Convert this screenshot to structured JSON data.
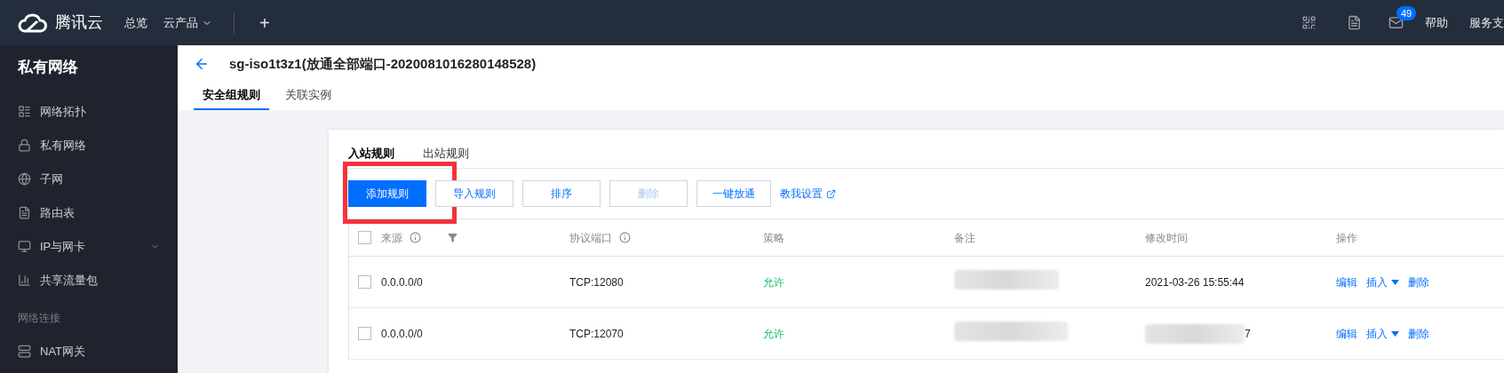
{
  "top_bar": {
    "brand": "腾讯云",
    "nav": [
      {
        "label": "总览",
        "dropdown": false
      },
      {
        "label": "云产品",
        "dropdown": true
      }
    ],
    "add": "+",
    "mail_badge": "49",
    "links": [
      "帮助",
      "服务支"
    ]
  },
  "sidebar": {
    "title": "私有网络",
    "items": [
      {
        "kind": "item",
        "label": "网络拓扑",
        "expandable": false
      },
      {
        "kind": "item",
        "label": "私有网络",
        "expandable": false
      },
      {
        "kind": "item",
        "label": "子网",
        "expandable": false
      },
      {
        "kind": "item",
        "label": "路由表",
        "expandable": false
      },
      {
        "kind": "item",
        "label": "IP与网卡",
        "expandable": true
      },
      {
        "kind": "item",
        "label": "共享流量包",
        "expandable": false
      },
      {
        "kind": "section",
        "label": "网络连接"
      },
      {
        "kind": "item",
        "label": "NAT网关",
        "expandable": false
      }
    ]
  },
  "header": {
    "back": true,
    "title": "sg-iso1t3z1(放通全部端口-2020081016280148528)",
    "tabs": [
      {
        "label": "安全组规则",
        "selected": true
      },
      {
        "label": "关联实例",
        "selected": false
      }
    ]
  },
  "card": {
    "tabs": [
      {
        "label": "入站规则",
        "selected": true
      },
      {
        "label": "出站规则",
        "selected": false
      }
    ],
    "buttons": [
      {
        "label": "添加规则",
        "kind": "primary",
        "disabled": false,
        "highlighted": true
      },
      {
        "label": "导入规则",
        "kind": "default",
        "disabled": false,
        "highlighted": false
      },
      {
        "label": "排序",
        "kind": "default",
        "disabled": false,
        "highlighted": false
      },
      {
        "label": "删除",
        "kind": "default",
        "disabled": true,
        "highlighted": false
      },
      {
        "label": "一键放通",
        "kind": "default",
        "disabled": false,
        "highlighted": false
      }
    ],
    "help_link": "教我设置",
    "table": {
      "all_checked": false,
      "columns": [
        "来源",
        "协议端口",
        "策略",
        "备注",
        "修改时间",
        "操作"
      ],
      "rows": [
        {
          "checked": false,
          "source": "0.0.0.0/0",
          "port": "TCP:12080",
          "policy": "允许",
          "note_redacted": true,
          "time": "2021-03-26 15:55:44",
          "time_redacted": false,
          "actions": [
            "编辑",
            "插入",
            "删除"
          ]
        },
        {
          "checked": false,
          "source": "0.0.0.0/0",
          "port": "TCP:12070",
          "policy": "允许",
          "note_redacted": true,
          "time": "7",
          "time_redacted": true,
          "actions": [
            "编辑",
            "插入",
            "删除"
          ]
        }
      ]
    }
  }
}
